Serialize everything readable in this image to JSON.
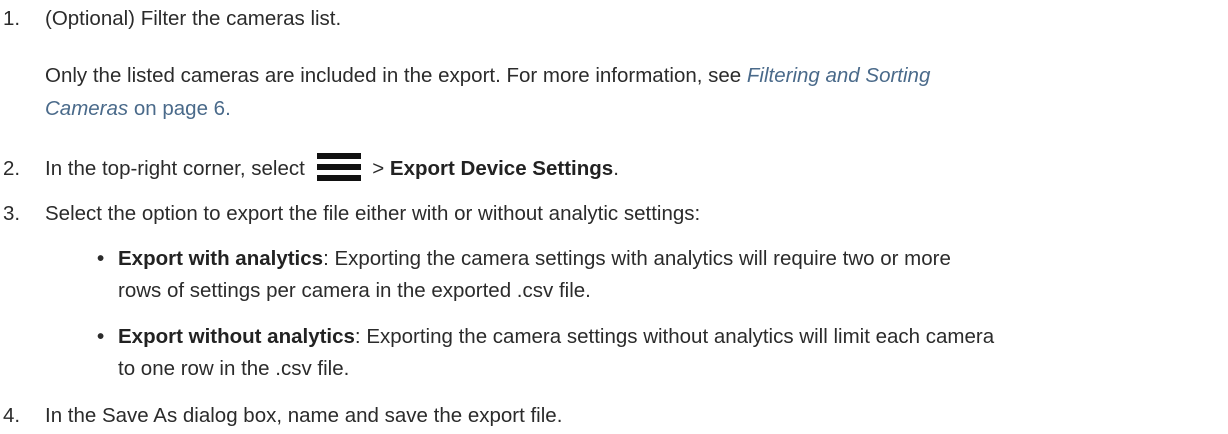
{
  "steps": [
    {
      "number": "1.",
      "text": "(Optional) Filter the cameras list.",
      "note_line1_prefix": "Only the listed cameras are included in the export. For more information, see ",
      "note_link_part1": "Filtering and Sorting",
      "note_link_part2": "Cameras",
      "note_suffix": " on page 6."
    },
    {
      "number": "2.",
      "prefix": "In the top-right corner, select",
      "icon": "hamburger-menu-icon",
      "separator": " > ",
      "bold": "Export Device Settings",
      "suffix": "."
    },
    {
      "number": "3.",
      "text": "Select the option to export the file either with or without analytic settings:",
      "bullets": [
        {
          "bold": "Export with analytics",
          "line1": ": Exporting the camera settings with analytics will require two or more",
          "line2": "rows of settings per camera in the exported .csv file."
        },
        {
          "bold": "Export without analytics",
          "line1": ": Exporting the camera settings without analytics will limit each camera",
          "line2": "to one row in the .csv file."
        }
      ]
    },
    {
      "number": "4.",
      "text": "In the Save As dialog box, name and save the export file."
    }
  ],
  "colors": {
    "text": "#2b2b2b",
    "link": "#4a6a8a"
  }
}
